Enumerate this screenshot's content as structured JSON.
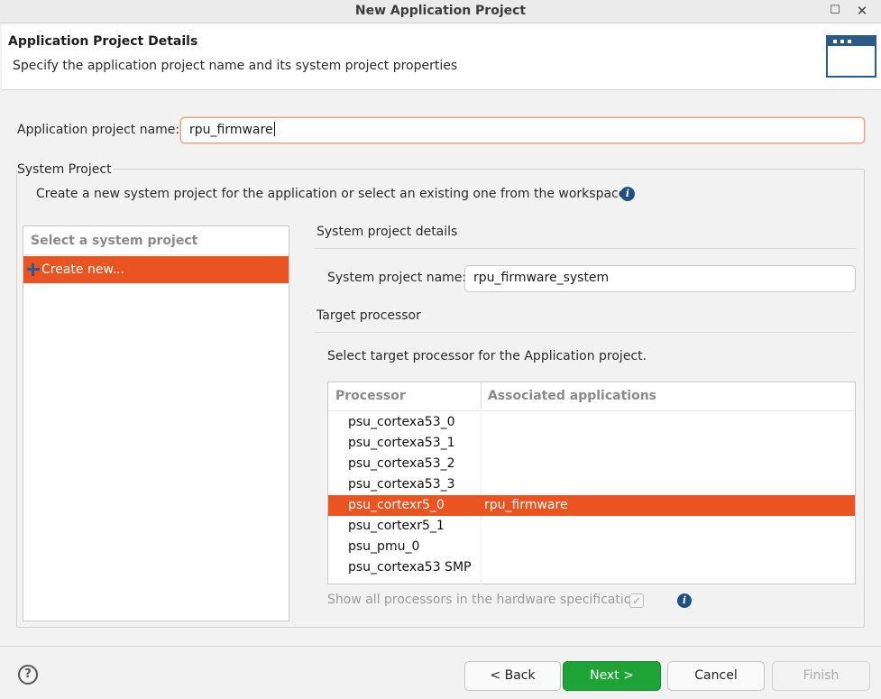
{
  "window": {
    "title": "New Application Project",
    "maximize_icon": "maximize-icon",
    "close_icon": "close-icon"
  },
  "header": {
    "title": "Application Project Details",
    "subtitle": "Specify the application project name and its system project properties",
    "icon": "wizard-window-icon"
  },
  "app_name": {
    "label": "Application project name:",
    "value": "rpu_firmware"
  },
  "system_project": {
    "legend": "System Project",
    "description": "Create a new system project for the application or select an existing one from the workspace",
    "list": {
      "header": "Select a system project",
      "items": [
        {
          "label": "Create new...",
          "icon": "plus-icon",
          "selected": true
        }
      ]
    },
    "details": {
      "title": "System project details",
      "name_label": "System project name:",
      "name_value": "rpu_firmware_system"
    },
    "target": {
      "title": "Target processor",
      "instruction": "Select target processor for the Application project.",
      "columns": [
        "Processor",
        "Associated applications"
      ],
      "rows": [
        {
          "processor": "psu_cortexa53_0",
          "apps": ""
        },
        {
          "processor": "psu_cortexa53_1",
          "apps": ""
        },
        {
          "processor": "psu_cortexa53_2",
          "apps": ""
        },
        {
          "processor": "psu_cortexa53_3",
          "apps": ""
        },
        {
          "processor": "psu_cortexr5_0",
          "apps": "rpu_firmware"
        },
        {
          "processor": "psu_cortexr5_1",
          "apps": ""
        },
        {
          "processor": "psu_pmu_0",
          "apps": ""
        },
        {
          "processor": "psu_cortexa53 SMP",
          "apps": ""
        }
      ],
      "selected_row": "psu_cortexr5_0",
      "show_all_label": "Show all processors in the hardware specification",
      "show_all_checked": true,
      "show_all_enabled": false
    }
  },
  "buttons": {
    "help_icon": "help-icon",
    "back": "< Back",
    "next": "Next >",
    "cancel": "Cancel",
    "finish": "Finish"
  },
  "colors": {
    "selection": "#e95420",
    "primary_button": "#1ea337",
    "info_icon": "#1f4f86"
  }
}
